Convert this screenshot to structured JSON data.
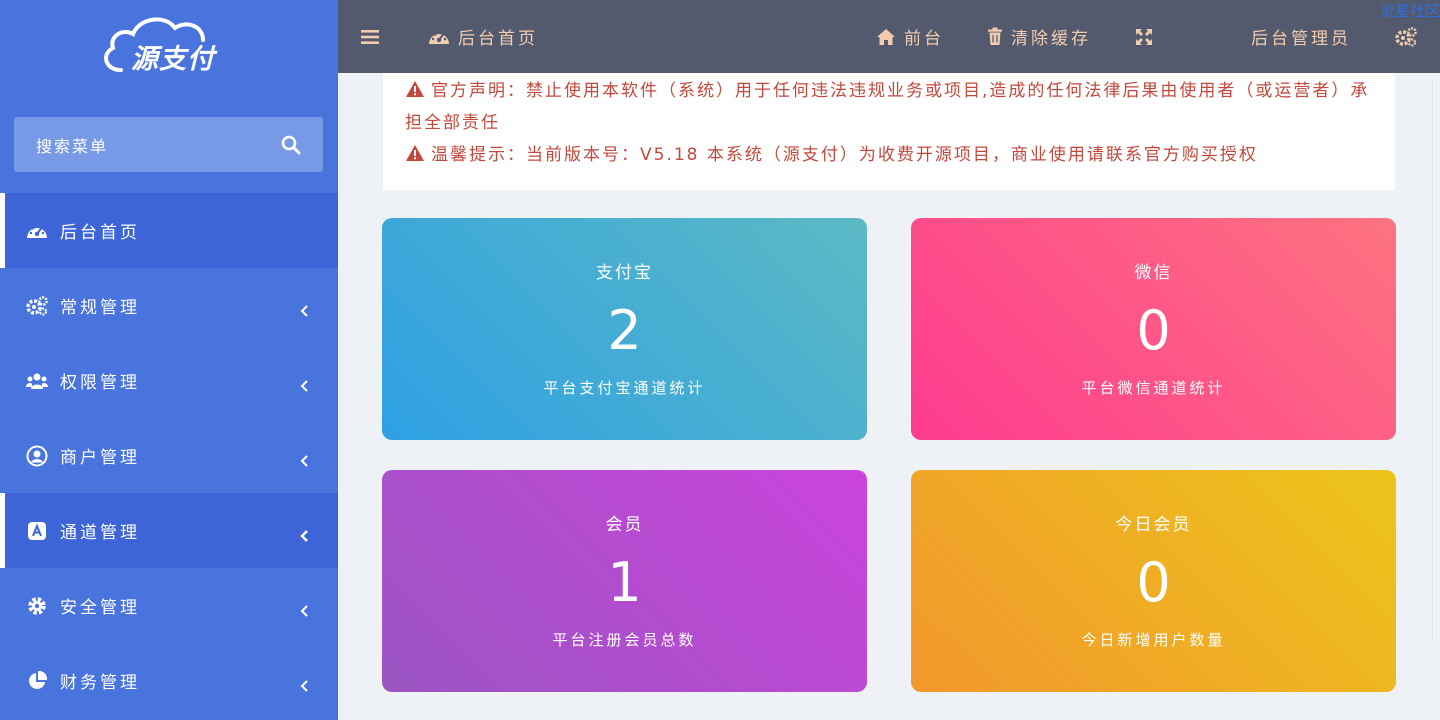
{
  "brand": {
    "logo_text": "源支付"
  },
  "search": {
    "placeholder": "搜索菜单"
  },
  "sidebar": {
    "items": [
      {
        "label": "后台首页",
        "icon": "dashboard-icon",
        "active": true,
        "has_children": false
      },
      {
        "label": "常规管理",
        "icon": "cogs-icon",
        "active": false,
        "has_children": true
      },
      {
        "label": "权限管理",
        "icon": "users-icon",
        "active": false,
        "has_children": true
      },
      {
        "label": "商户管理",
        "icon": "user-circle-icon",
        "active": false,
        "has_children": true
      },
      {
        "label": "通道管理",
        "icon": "app-store-icon",
        "active": true,
        "has_children": true
      },
      {
        "label": "安全管理",
        "icon": "gear-icon",
        "active": false,
        "has_children": true
      },
      {
        "label": "财务管理",
        "icon": "pie-chart-icon",
        "active": false,
        "has_children": true
      }
    ]
  },
  "topbar": {
    "menu_toggle_icon": "bars-icon",
    "current_page": "后台首页",
    "frontend": "前台",
    "clear_cache": "清除缓存",
    "fullscreen_icon": "expand-icon",
    "admin_name": "后台管理员",
    "settings_icon": "cogs-icon",
    "watermark": "流星社区"
  },
  "notice": {
    "line1": "官方声明：禁止使用本软件（系统）用于任何违法违规业务或项目,造成的任何法律后果由使用者（或运营者）承担全部责任",
    "line2": "温馨提示：当前版本号：V5.18 本系统（源支付）为收费开源项目，商业使用请联系官方购买授权"
  },
  "stats": [
    {
      "title": "支付宝",
      "value": "2",
      "subtitle": "平台支付宝通道统计"
    },
    {
      "title": "微信",
      "value": "0",
      "subtitle": "平台微信通道统计"
    },
    {
      "title": "会员",
      "value": "1",
      "subtitle": "平台注册会员总数"
    },
    {
      "title": "今日会员",
      "value": "0",
      "subtitle": "今日新增用户数量"
    }
  ],
  "colors": {
    "sidebar_bg": "#4a74dd",
    "topbar_bg": "#535a6d",
    "notice_text": "#c4493c",
    "alipay_gradient": [
      "#5cbac4",
      "#2ea0e4"
    ],
    "wechat_gradient": [
      "#fd7380",
      "#fe3b8f"
    ],
    "member_gradient": [
      "#cb44dc",
      "#9a55c2"
    ],
    "today_gradient": [
      "#ecc51b",
      "#f2972c"
    ]
  }
}
